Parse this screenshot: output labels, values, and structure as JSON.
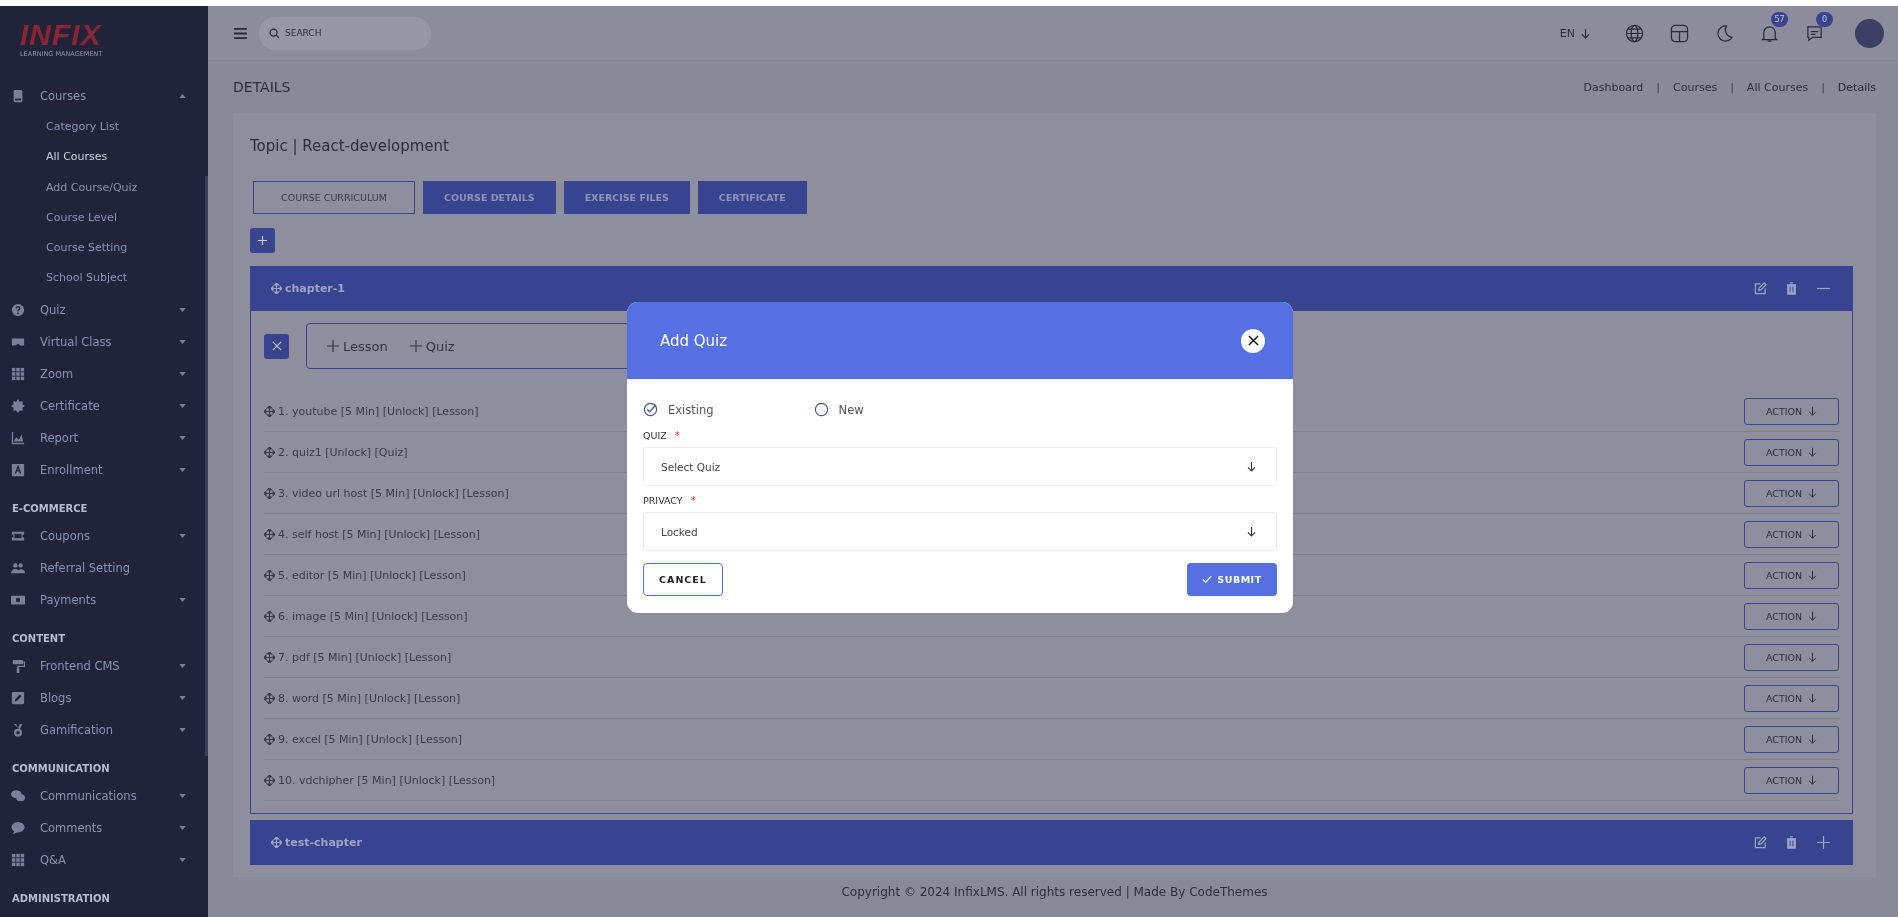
{
  "sidebar": {
    "logo": {
      "name": "INFIX",
      "tagline": "LEARNING MANAGEMENT"
    },
    "sections": [
      {
        "items": [
          {
            "label": "Courses",
            "kind": "menu",
            "expanded": true,
            "children": [
              {
                "label": "Category List",
                "selected": false
              },
              {
                "label": "All Courses",
                "selected": true
              },
              {
                "label": "Add Course/Quiz",
                "selected": false
              },
              {
                "label": "Course Level",
                "selected": false
              },
              {
                "label": "Course Setting",
                "selected": false
              },
              {
                "label": "School Subject",
                "selected": false
              }
            ]
          },
          {
            "label": "Quiz",
            "kind": "menu",
            "expanded": false
          },
          {
            "label": "Virtual Class",
            "kind": "menu",
            "expanded": false
          },
          {
            "label": "Zoom",
            "kind": "menu",
            "expanded": false
          },
          {
            "label": "Certificate",
            "kind": "menu",
            "expanded": false
          },
          {
            "label": "Report",
            "kind": "menu",
            "expanded": false
          },
          {
            "label": "Enrollment",
            "kind": "menu",
            "expanded": false
          }
        ]
      },
      {
        "heading": "E-COMMERCE",
        "items": [
          {
            "label": "Coupons",
            "kind": "menu",
            "expanded": false
          },
          {
            "label": "Referral Setting",
            "kind": "link"
          },
          {
            "label": "Payments",
            "kind": "menu",
            "expanded": false
          }
        ]
      },
      {
        "heading": "CONTENT",
        "items": [
          {
            "label": "Frontend CMS",
            "kind": "menu",
            "expanded": false
          },
          {
            "label": "Blogs",
            "kind": "menu",
            "expanded": false
          },
          {
            "label": "Gamification",
            "kind": "menu",
            "expanded": false
          }
        ]
      },
      {
        "heading": "COMMUNICATION",
        "items": [
          {
            "label": "Communications",
            "kind": "menu",
            "expanded": false
          },
          {
            "label": "Comments",
            "kind": "menu",
            "expanded": false
          },
          {
            "label": "Q&A",
            "kind": "menu",
            "expanded": false
          }
        ]
      },
      {
        "heading": "ADMINISTRATION"
      }
    ]
  },
  "topbar": {
    "search": {
      "placeholder": "SEARCH"
    },
    "language": "EN",
    "notifications": "57",
    "messages": "0"
  },
  "page": {
    "title": "DETAILS",
    "breadcrumb": [
      {
        "kind": "link",
        "text": "Dashboard"
      },
      {
        "kind": "separator",
        "text": "|"
      },
      {
        "kind": "link",
        "text": "Courses"
      },
      {
        "kind": "separator",
        "text": "|"
      },
      {
        "kind": "link",
        "text": "All Courses"
      },
      {
        "kind": "separator",
        "text": "|"
      },
      {
        "kind": "current",
        "text": "Details"
      }
    ]
  },
  "topic": {
    "title": "Topic | React-development",
    "tabs": [
      {
        "label": "COURSE CURRICULUM",
        "selected": true
      },
      {
        "label": "COURSE DETAILS",
        "selected": false
      },
      {
        "label": "EXERCISE FILES",
        "selected": false
      },
      {
        "label": "CERTIFICATE",
        "selected": false
      }
    ],
    "chapters": [
      {
        "name": "chapter-1",
        "expanded": true,
        "add_options": [
          "Lesson",
          "Quiz"
        ],
        "lessons": [
          {
            "text": "1. youtube [5 Min] [Unlock] [Lesson]",
            "action": "ACTION"
          },
          {
            "text": "2. quiz1 [Unlock] [Quiz]",
            "action": "ACTION"
          },
          {
            "text": "3. video url host [5 Min] [Unlock] [Lesson]",
            "action": "ACTION"
          },
          {
            "text": "4. self host [5 Min] [Unlock] [Lesson]",
            "action": "ACTION"
          },
          {
            "text": "5. editor [5 Min] [Unlock] [Lesson]",
            "action": "ACTION"
          },
          {
            "text": "6. image [5 Min] [Unlock] [Lesson]",
            "action": "ACTION"
          },
          {
            "text": "7. pdf [5 Min] [Unlock] [Lesson]",
            "action": "ACTION"
          },
          {
            "text": "8. word [5 Min] [Unlock] [Lesson]",
            "action": "ACTION"
          },
          {
            "text": "9. excel [5 Min] [Unlock] [Lesson]",
            "action": "ACTION"
          },
          {
            "text": "10. vdchipher [5 Min] [Unlock] [Lesson]",
            "action": "ACTION"
          }
        ]
      },
      {
        "name": "test-chapter",
        "expanded": false
      }
    ]
  },
  "footer": "Copyright © 2024 InfixLMS. All rights reserved | Made By CodeThemes",
  "modal": {
    "title": "Add Quiz",
    "options": [
      {
        "label": "Existing",
        "selected": true
      },
      {
        "label": "New",
        "selected": false
      }
    ],
    "fields": [
      {
        "label": "QUIZ",
        "required_mark": "*",
        "value": "Select Quiz"
      },
      {
        "label": "PRIVACY",
        "required_mark": "*",
        "value": "Locked"
      }
    ],
    "cancel": "CANCEL",
    "submit": "SUBMIT"
  }
}
